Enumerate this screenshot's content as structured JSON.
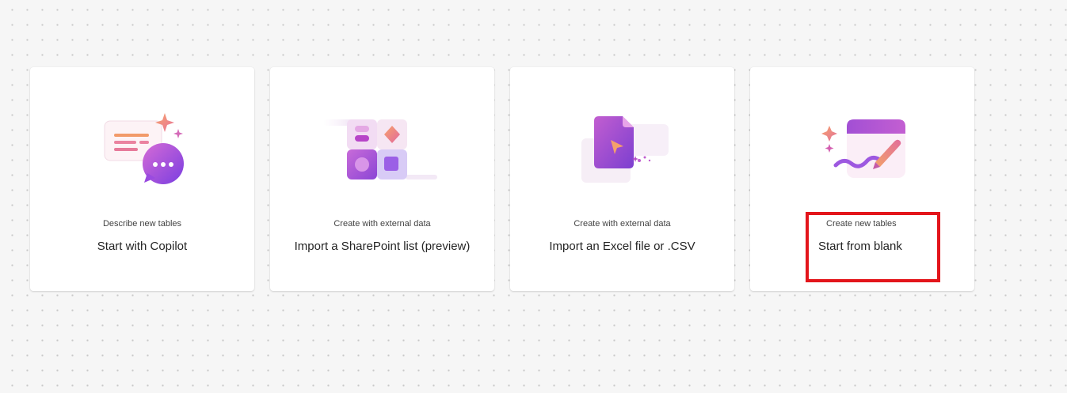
{
  "cards": [
    {
      "subtitle": "Describe new tables",
      "title": "Start with Copilot",
      "icon": "copilot-chat-icon"
    },
    {
      "subtitle": "Create with external data",
      "title": "Import a SharePoint list (preview)",
      "icon": "sharepoint-list-icon"
    },
    {
      "subtitle": "Create with external data",
      "title": "Import an Excel file or .CSV",
      "icon": "excel-file-icon"
    },
    {
      "subtitle": "Create new tables",
      "title": "Start from blank",
      "icon": "blank-table-pen-icon"
    }
  ],
  "colors": {
    "accent_purple": "#8a3fd1",
    "accent_pink": "#e06fb0",
    "accent_orange": "#f0915a",
    "highlight_red": "#e3151b"
  }
}
